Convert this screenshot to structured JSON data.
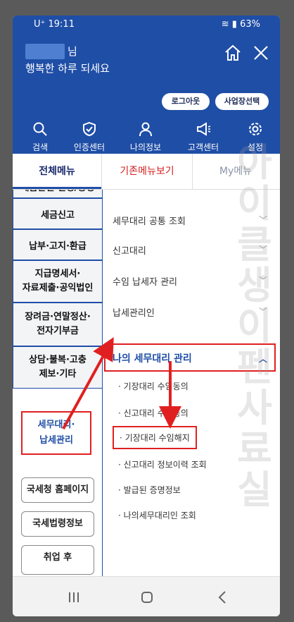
{
  "status": {
    "carrier_time": "U⁺ 19:11",
    "battery": "63%"
  },
  "header": {
    "greeting_suffix": "님",
    "greeting_line2": "행복한 하루 되세요",
    "logout_label": "로그아웃",
    "select_business_label": "사업장선택"
  },
  "quick_menu": [
    {
      "label": "검색",
      "icon": "search-icon"
    },
    {
      "label": "인증센터",
      "icon": "shield-check-icon"
    },
    {
      "label": "나의정보",
      "icon": "person-icon"
    },
    {
      "label": "고객센터",
      "icon": "megaphone-icon"
    },
    {
      "label": "설정",
      "icon": "gear-icon"
    }
  ],
  "tabs": {
    "all_menu": "전체메뉴",
    "basic_menu": "기존메뉴보기",
    "my_menu": "My메뉴"
  },
  "left_categories": [
    {
      "label": "세금관련 신청/증명"
    },
    {
      "label": "세금신고"
    },
    {
      "label": "납부·고지·환급"
    },
    {
      "label": "지급명세서·\n자료제출·공익법인"
    },
    {
      "label": "장려금·연말정산·\n전자기부금"
    },
    {
      "label": "상담·불복·고충\n제보·기타"
    },
    {
      "label": "세무대리·\n납세관리"
    }
  ],
  "external_links": [
    {
      "label": "국세청 홈페이지"
    },
    {
      "label": "국세법령정보"
    },
    {
      "label": "취업 후"
    }
  ],
  "right_menu": [
    {
      "label": "세무대리 공통 조회"
    },
    {
      "label": "신고대리"
    },
    {
      "label": "수임 납세자 관리"
    },
    {
      "label": "납세관리인"
    },
    {
      "label": "나의 세무대리 관리"
    }
  ],
  "sub_items": [
    {
      "label": "· 기장대리 수임동의"
    },
    {
      "label": "· 신고대리 수임동의"
    },
    {
      "label": "· 기장대리 수임해지"
    },
    {
      "label": "· 신고대리 정보이력 조회"
    },
    {
      "label": "· 발급된 증명정보"
    },
    {
      "label": "· 나의세무대리인 조회"
    }
  ],
  "watermark": "아이클생이펜사료실",
  "colors": {
    "brand_blue": "#1f4ea6",
    "highlight_red": "#e02020"
  }
}
